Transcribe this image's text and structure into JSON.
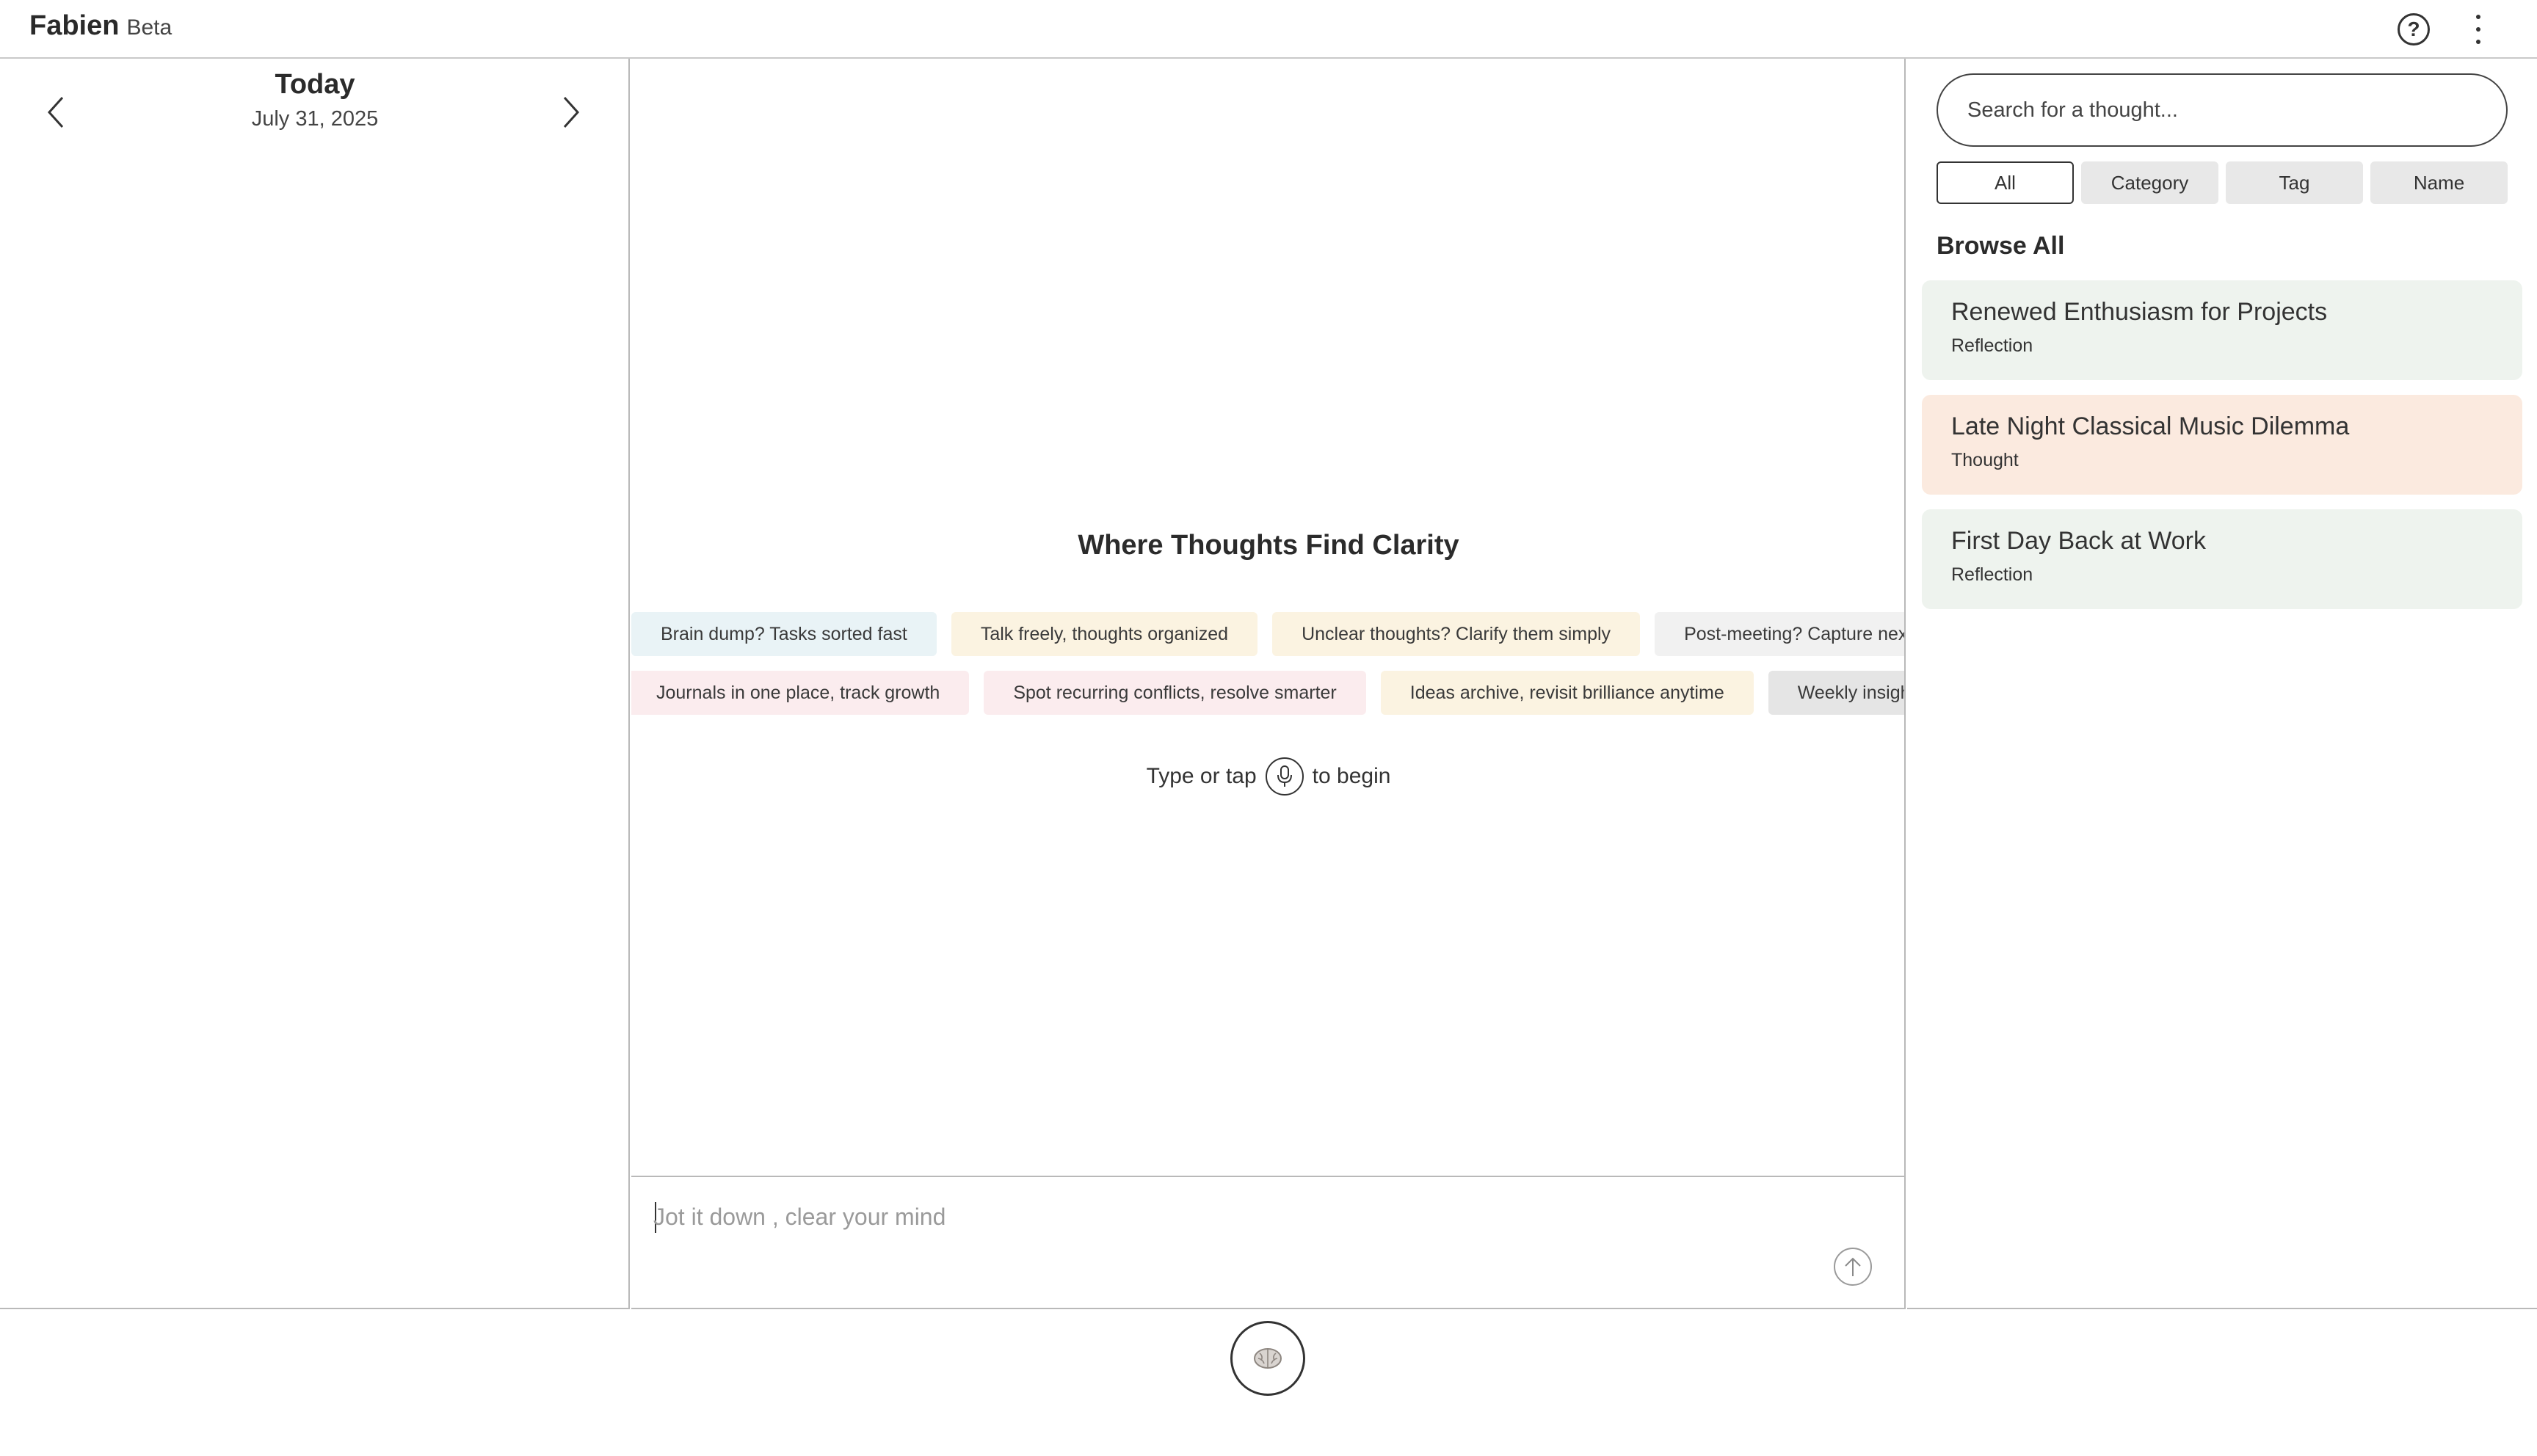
{
  "app": {
    "name": "Fabien",
    "tag": "Beta"
  },
  "header": {
    "help_icon": "help-circle-icon",
    "menu_icon": "more-vertical-icon"
  },
  "date_nav": {
    "title": "Today",
    "date": "July 31, 2025",
    "prev_icon": "chevron-left-icon",
    "next_icon": "chevron-right-icon"
  },
  "main": {
    "headline": "Where Thoughts Find Clarity",
    "chips_row1": [
      {
        "label": "Brain dump? Tasks sorted fast",
        "color": "#e9f3f6"
      },
      {
        "label": "Talk freely, thoughts organized",
        "color": "#fbf3e1"
      },
      {
        "label": "Unclear thoughts? Clarify them simply",
        "color": "#fbf3e1"
      },
      {
        "label": "Post-meeting? Capture next steps",
        "color": "#f1f1f1"
      }
    ],
    "chips_row2": [
      {
        "label": "Journals in one place, track growth",
        "color": "#fbecee"
      },
      {
        "label": "Spot recurring conflicts, resolve smarter",
        "color": "#fbecee"
      },
      {
        "label": "Ideas archive, revisit brilliance anytime",
        "color": "#fbf3e1"
      },
      {
        "label": "Weekly insights",
        "color": "#e5e5e5"
      }
    ],
    "begin_prefix": "Type or tap",
    "begin_suffix": "to begin"
  },
  "compose": {
    "placeholder": "Jot it down , clear your mind",
    "value": "",
    "send_icon": "arrow-up-icon"
  },
  "search": {
    "placeholder": "Search for a thought..."
  },
  "filters": [
    {
      "label": "All",
      "active": true
    },
    {
      "label": "Category",
      "active": false
    },
    {
      "label": "Tag",
      "active": false
    },
    {
      "label": "Name",
      "active": false
    }
  ],
  "browse": {
    "title": "Browse All",
    "items": [
      {
        "title": "Renewed Enthusiasm for Projects",
        "category": "Reflection",
        "color": "#eef3ee"
      },
      {
        "title": "Late Night Classical Music Dilemma",
        "category": "Thought",
        "color": "#fbeadf"
      },
      {
        "title": "First Day Back at Work",
        "category": "Reflection",
        "color": "#eef3ee"
      }
    ]
  },
  "footer": {
    "brain_icon": "brain-icon"
  }
}
